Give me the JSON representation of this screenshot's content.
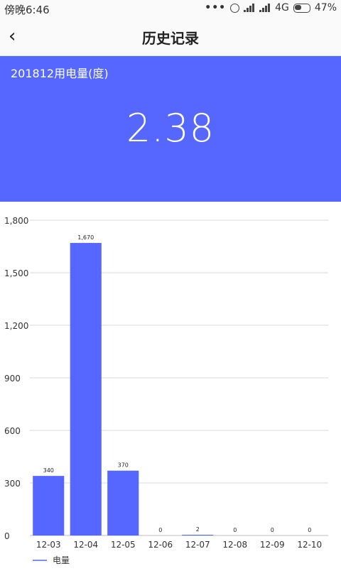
{
  "status_bar": {
    "time": "傍晚6:46",
    "network": "4G",
    "battery": "47%"
  },
  "nav": {
    "back_icon": "chevron-left-icon",
    "title": "历史记录"
  },
  "summary": {
    "label": "201812用电量(度)",
    "value": "2.38"
  },
  "colors": {
    "accent": "#5567ff",
    "grid": "#d9d9d9"
  },
  "chart_data": {
    "type": "bar",
    "categories": [
      "12-03",
      "12-04",
      "12-05",
      "12-06",
      "12-07",
      "12-08",
      "12-09",
      "12-10"
    ],
    "values": [
      340,
      1670,
      370,
      0,
      2,
      0,
      0,
      0
    ],
    "value_labels": [
      "340",
      "1,670",
      "370",
      "0",
      "2",
      "0",
      "0",
      "0"
    ],
    "series": [
      {
        "name": "电量",
        "values": [
          340,
          1670,
          370,
          0,
          2,
          0,
          0,
          0
        ]
      }
    ],
    "yticks": [
      0,
      300,
      600,
      900,
      1200,
      1500,
      1800
    ],
    "ytick_labels": [
      "0",
      "300",
      "600",
      "900",
      "1,200",
      "1,500",
      "1,800"
    ],
    "ylim": [
      0,
      1800
    ],
    "grid": true,
    "legend": "bottom-left",
    "title": "",
    "xlabel": "",
    "ylabel": ""
  }
}
